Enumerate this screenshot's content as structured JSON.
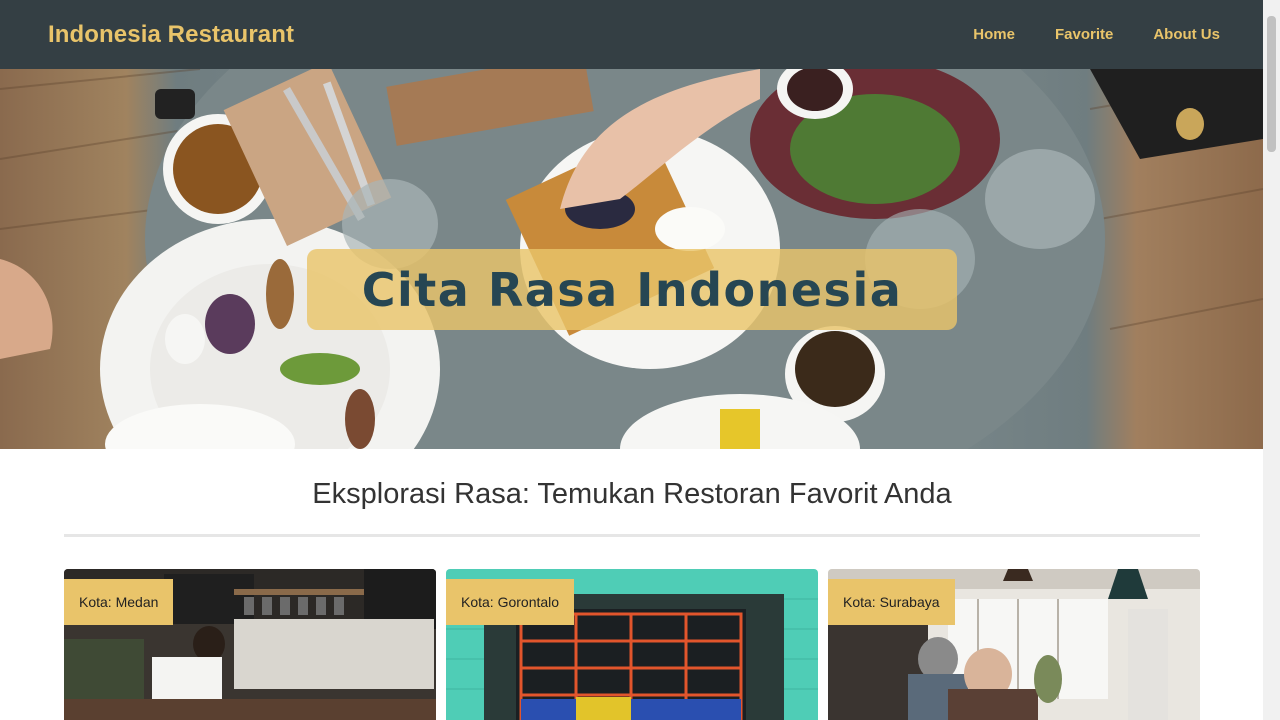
{
  "navbar": {
    "brand": "Indonesia Restaurant",
    "links": [
      "Home",
      "Favorite",
      "About Us"
    ]
  },
  "hero": {
    "title": "Cita Rasa Indonesia"
  },
  "section": {
    "heading": "Eksplorasi Rasa: Temukan Restoran Favorit Anda"
  },
  "cards": [
    {
      "city": "Kota: Medan"
    },
    {
      "city": "Kota: Gorontalo"
    },
    {
      "city": "Kota: Surabaya"
    }
  ],
  "colors": {
    "navbar_bg": "#343f44",
    "accent": "#e9c46a",
    "hero_text": "#264653"
  }
}
